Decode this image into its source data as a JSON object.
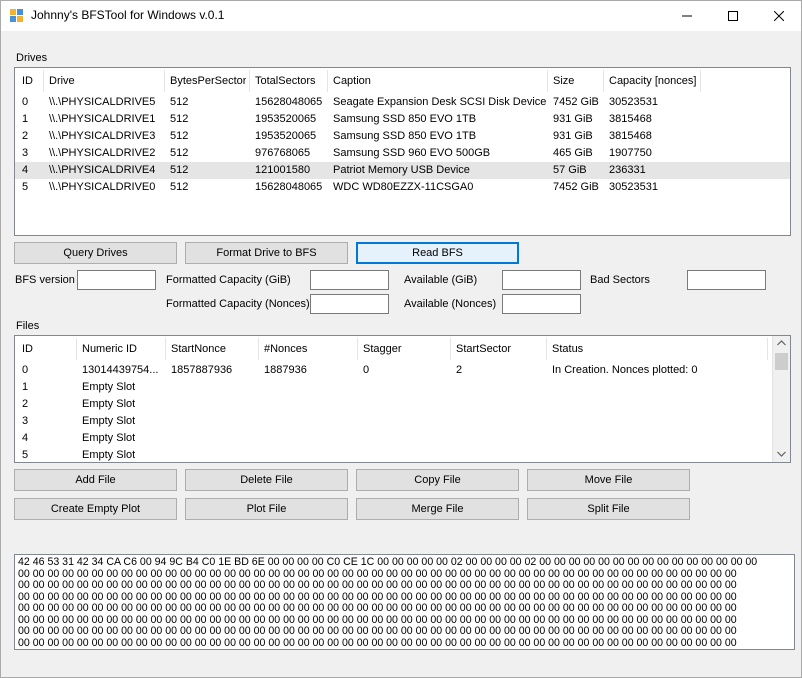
{
  "window": {
    "title": "Johnny's BFSTool for Windows v.0.1"
  },
  "drives": {
    "group_label": "Drives",
    "columns": [
      "ID",
      "Drive",
      "BytesPerSector",
      "TotalSectors",
      "Caption",
      "Size",
      "Capacity [nonces]"
    ],
    "rows": [
      [
        "0",
        "\\\\.\\PHYSICALDRIVE5",
        "512",
        "15628048065",
        "Seagate Expansion Desk SCSI Disk Device",
        "7452 GiB",
        "30523531"
      ],
      [
        "1",
        "\\\\.\\PHYSICALDRIVE1",
        "512",
        "1953520065",
        "Samsung SSD 850 EVO 1TB",
        "931 GiB",
        "3815468"
      ],
      [
        "2",
        "\\\\.\\PHYSICALDRIVE3",
        "512",
        "1953520065",
        "Samsung SSD 850 EVO 1TB",
        "931 GiB",
        "3815468"
      ],
      [
        "3",
        "\\\\.\\PHYSICALDRIVE2",
        "512",
        "976768065",
        "Samsung SSD 960 EVO 500GB",
        "465 GiB",
        "1907750"
      ],
      [
        "4",
        "\\\\.\\PHYSICALDRIVE4",
        "512",
        "121001580",
        "Patriot Memory USB Device",
        "57 GiB",
        "236331"
      ],
      [
        "5",
        "\\\\.\\PHYSICALDRIVE0",
        "512",
        "15628048065",
        "WDC WD80EZZX-11CSGA0",
        "7452 GiB",
        "30523531"
      ]
    ]
  },
  "buttons_top": {
    "query": "Query Drives",
    "format": "Format Drive to BFS",
    "read": "Read BFS"
  },
  "info": {
    "bfs_version_label": "BFS version",
    "formatted_gib_label": "Formatted Capacity (GiB)",
    "formatted_nonces_label": "Formatted Capacity (Nonces)",
    "available_gib_label": "Available (GiB)",
    "available_nonces_label": "Available (Nonces)",
    "bad_sectors_label": "Bad Sectors"
  },
  "files": {
    "group_label": "Files",
    "columns": [
      "ID",
      "Numeric ID",
      "StartNonce",
      "#Nonces",
      "Stagger",
      "StartSector",
      "Status"
    ],
    "rows": [
      [
        "0",
        "13014439754...",
        "1857887936",
        "1887936",
        "0",
        "2",
        "In Creation. Nonces plotted: 0"
      ],
      [
        "1",
        "Empty Slot",
        "",
        "",
        "",
        "",
        ""
      ],
      [
        "2",
        "Empty Slot",
        "",
        "",
        "",
        "",
        ""
      ],
      [
        "3",
        "Empty Slot",
        "",
        "",
        "",
        "",
        ""
      ],
      [
        "4",
        "Empty Slot",
        "",
        "",
        "",
        "",
        ""
      ],
      [
        "5",
        "Empty Slot",
        "",
        "",
        "",
        "",
        ""
      ]
    ]
  },
  "buttons_files": {
    "add": "Add File",
    "delete": "Delete File",
    "copy": "Copy File",
    "move": "Move File",
    "create_empty": "Create Empty Plot",
    "plot": "Plot File",
    "merge": "Merge File",
    "split": "Split File"
  },
  "hex": {
    "lines": [
      "42 46 53 31 42 34 CA C6 00 94 9C B4 C0 1E BD 6E 00 00 00 00 C0 CE 1C 00 00 00 00 00 02 00 00 00 00 02 00 00 00 00 00 00 00 00 00 00 00 00 00 00 00",
      "00 00 00 00 00 00 00 00 00 00 00 00 00 00 00 00 00 00 00 00 00 00 00 00 00 00 00 00 00 00 00 00 00 00 00 00 00 00 00 00 00 00 00 00 00 00 00 00 00",
      "00 00 00 00 00 00 00 00 00 00 00 00 00 00 00 00 00 00 00 00 00 00 00 00 00 00 00 00 00 00 00 00 00 00 00 00 00 00 00 00 00 00 00 00 00 00 00 00 00",
      "00 00 00 00 00 00 00 00 00 00 00 00 00 00 00 00 00 00 00 00 00 00 00 00 00 00 00 00 00 00 00 00 00 00 00 00 00 00 00 00 00 00 00 00 00 00 00 00 00",
      "00 00 00 00 00 00 00 00 00 00 00 00 00 00 00 00 00 00 00 00 00 00 00 00 00 00 00 00 00 00 00 00 00 00 00 00 00 00 00 00 00 00 00 00 00 00 00 00 00",
      "00 00 00 00 00 00 00 00 00 00 00 00 00 00 00 00 00 00 00 00 00 00 00 00 00 00 00 00 00 00 00 00 00 00 00 00 00 00 00 00 00 00 00 00 00 00 00 00 00",
      "00 00 00 00 00 00 00 00 00 00 00 00 00 00 00 00 00 00 00 00 00 00 00 00 00 00 00 00 00 00 00 00 00 00 00 00 00 00 00 00 00 00 00 00 00 00 00 00 00",
      "00 00 00 00 00 00 00 00 00 00 00 00 00 00 00 00 00 00 00 00 00 00 00 00 00 00 00 00 00 00 00 00 00 00 00 00 00 00 00 00 00 00 00 00 00 00 00 00 00"
    ]
  },
  "colors": {
    "selected_row": "#e5e5e5",
    "focus_border": "#0078d7"
  },
  "icons": {
    "app": "app-icon",
    "minimize": "minimize-icon",
    "maximize": "maximize-icon",
    "close": "close-icon"
  }
}
